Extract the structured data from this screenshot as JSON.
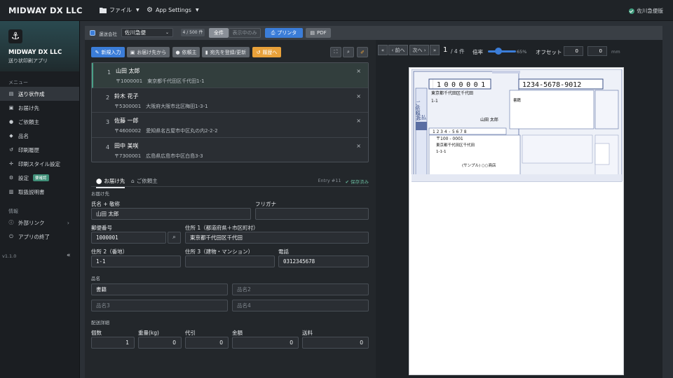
{
  "topbar": {
    "brand": "MIDWAY DX LLC",
    "file_menu": "ファイル",
    "settings_menu": "App Settings",
    "status": "佐川急便版"
  },
  "sidebar": {
    "title": "MIDWAY DX LLC",
    "subtitle": "送り状印刷アプリ",
    "section_menu": "メニュー",
    "items": [
      {
        "label": "送り状作成",
        "icon": "file-icon"
      },
      {
        "label": "お届け先",
        "icon": "address-icon"
      },
      {
        "label": "ご依頼主",
        "icon": "user-icon"
      },
      {
        "label": "品名",
        "icon": "tag-icon"
      },
      {
        "label": "印刷履歴",
        "icon": "history-icon"
      },
      {
        "label": "印刷スタイル設定",
        "icon": "style-icon"
      },
      {
        "label": "設定",
        "icon": "gear-icon",
        "badge": "要確認"
      },
      {
        "label": "取扱説明書",
        "icon": "book-icon"
      }
    ],
    "section_info": "情報",
    "info_items": [
      {
        "label": "外部リンク"
      },
      {
        "label": "アプリの終了"
      }
    ],
    "version": "v1.1.0"
  },
  "toolbar": {
    "carrier_label": "運送会社",
    "carrier_value": "佐川急便",
    "count": "4 / 500 件",
    "all": "全件",
    "filtered": "表示中のみ",
    "print": "プリンタ",
    "pdf": "PDF"
  },
  "actions": {
    "new": "新規入力",
    "from_addr": "お届け先から",
    "client": "依頼主",
    "register": "宛先を登録/更新",
    "history": "履歴へ"
  },
  "list": [
    {
      "num": "1",
      "name": "山田 太郎",
      "addr": "〒1000001　東京都千代田区千代田1-1"
    },
    {
      "num": "2",
      "name": "鈴木 花子",
      "addr": "〒5300001　大阪府大阪市北区梅田1-3-1"
    },
    {
      "num": "3",
      "name": "佐藤 一郎",
      "addr": "〒4600002　愛知県名古屋市中区丸の内2-2-2"
    },
    {
      "num": "4",
      "name": "田中 美咲",
      "addr": "〒7300001　広島県広島市中区白島3-3"
    }
  ],
  "tabs": {
    "dest": "お届け先",
    "client": "ご依頼主",
    "entry": "Entry #11",
    "saved": "保存済み"
  },
  "form": {
    "section": "お届け先",
    "name_label": "氏名 + 敬称",
    "name": "山田 太郎",
    "kana_label": "フリガナ",
    "kana": "",
    "zip_label": "郵便番号",
    "zip": "1000001",
    "addr1_label": "住所 1（都道府県＋市区町村）",
    "addr1": "東京都千代田区千代田",
    "addr2_label": "住所 2（番地）",
    "addr2": "1-1",
    "addr3_label": "住所 3（建物・マンション）",
    "addr3": "",
    "tel_label": "電話",
    "tel": "0312345678",
    "item_section": "品名",
    "item1": "書籍",
    "item2_ph": "品名2",
    "item3_ph": "品名3",
    "item4_ph": "品名4",
    "ship_section": "配送詳細",
    "qty_label": "個数",
    "qty": "1",
    "weight_label": "重量(kg)",
    "weight": "0",
    "cod_label": "代引",
    "cod": "0",
    "amount_label": "金額",
    "amount": "0",
    "fee_label": "送料",
    "fee": "0"
  },
  "preview": {
    "prev": "前へ",
    "next": "次へ",
    "page": "1",
    "of": "/ 4 件",
    "zoom_label": "倍率",
    "zoom": "65%",
    "offset_label": "オフセット",
    "off_x": "0",
    "off_y": "0",
    "unit": "mm",
    "slip": {
      "zip": "1000001",
      "tracking": "1234-5678-9012",
      "addr": "東京都千代田区千代田",
      "addr2": "1-1",
      "item": "書籍",
      "name": "山田 太郎",
      "tel": "1234-5678",
      "from_zip": "〒100 - 0001",
      "from_addr": "東京都千代田区千代田",
      "from_addr2": "1-1-1",
      "from_name": "(サンプル) ○○商店",
      "vertical": "ご依頼主",
      "pay": "元払"
    }
  }
}
